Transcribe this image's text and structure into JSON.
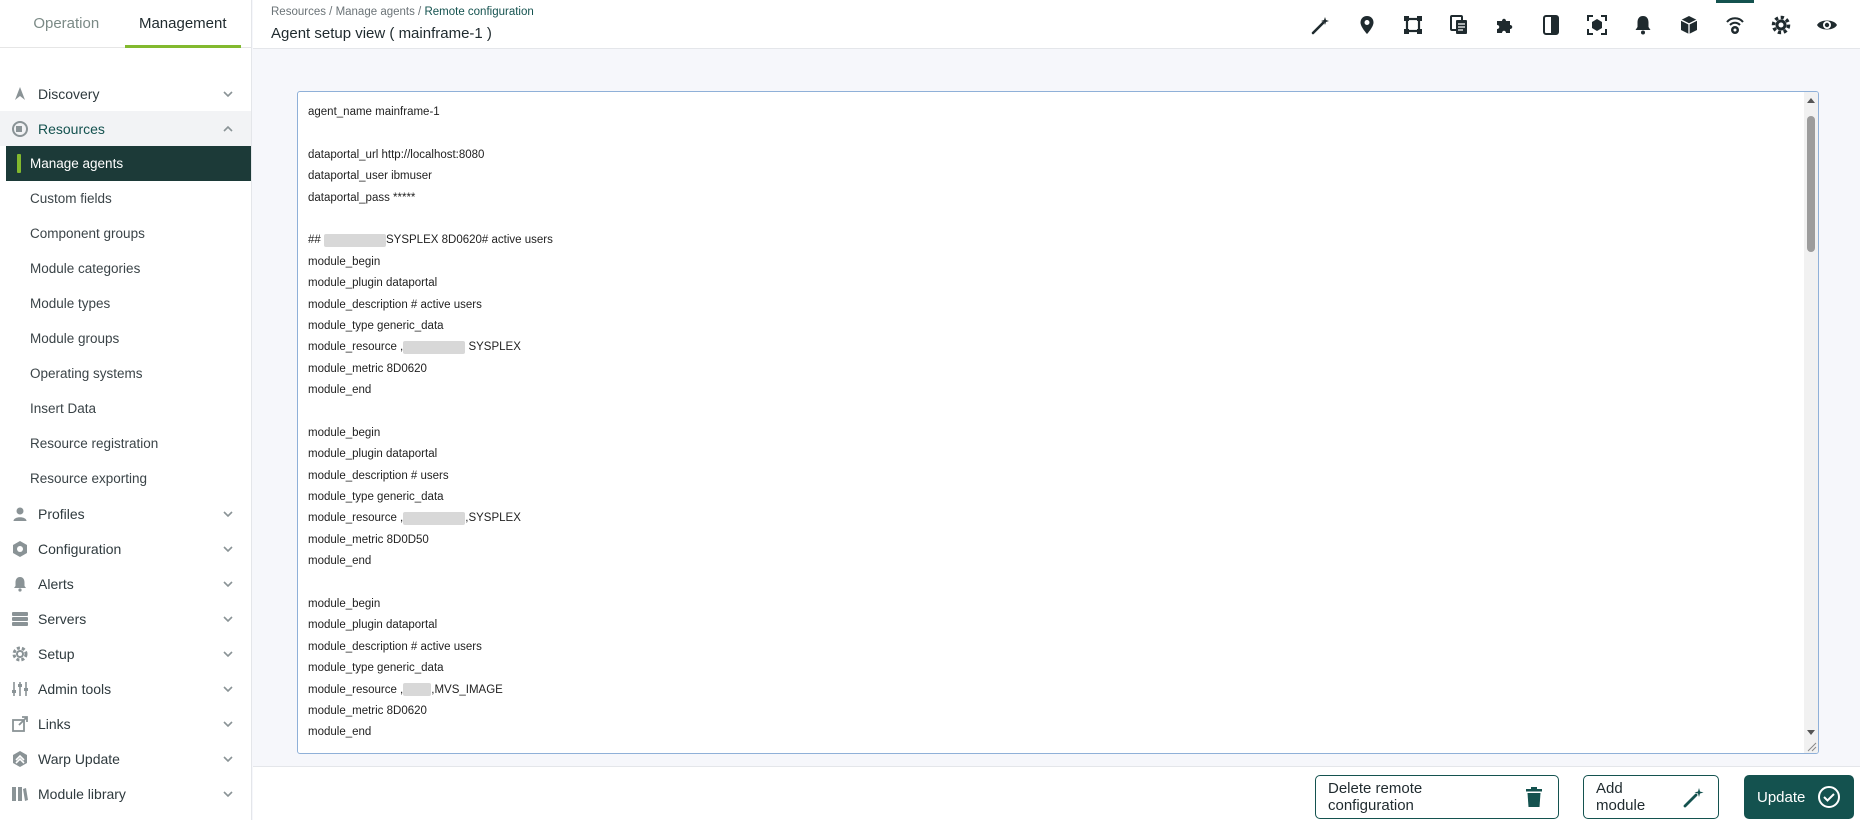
{
  "sidebar": {
    "tabs": [
      {
        "label": "Operation",
        "active": false
      },
      {
        "label": "Management",
        "active": true
      }
    ],
    "menu": {
      "discovery": "Discovery",
      "resources": "Resources",
      "resources_sub": [
        "Manage agents",
        "Custom fields",
        "Component groups",
        "Module categories",
        "Module types",
        "Module groups",
        "Operating systems",
        "Insert Data",
        "Resource registration",
        "Resource exporting"
      ],
      "profiles": "Profiles",
      "configuration": "Configuration",
      "alerts": "Alerts",
      "servers": "Servers",
      "setup": "Setup",
      "admin_tools": "Admin tools",
      "links": "Links",
      "warp_update": "Warp Update",
      "module_library": "Module library"
    }
  },
  "header": {
    "breadcrumb": {
      "part1": "Resources",
      "sep": " / ",
      "part2": "Manage agents",
      "current": "Remote configuration"
    },
    "title": "Agent setup view ( mainframe-1 )",
    "toolbar_icons": [
      "wand-icon",
      "map-pin-icon",
      "frame-icon",
      "copy-files-icon",
      "puzzle-icon",
      "panel-icon",
      "focus-icon",
      "bell-icon",
      "cube-icon",
      "wifi-gear-icon",
      "gear-icon",
      "eye-icon"
    ],
    "active_toolbar_icon": "wifi-gear-icon"
  },
  "editor": {
    "lines": [
      "agent_name mainframe-1",
      "",
      "dataportal_url http://localhost:8080",
      "dataportal_user ibmuser",
      "dataportal_pass *****",
      "",
      "## [REDACTED]SYSPLEX 8D0620# active users",
      "module_begin",
      "module_plugin dataportal",
      "module_description # active users",
      "module_type generic_data",
      "module_resource ,[REDACTED] SYSPLEX",
      "module_metric 8D0620",
      "module_end",
      "",
      "module_begin",
      "module_plugin dataportal",
      "module_description # users",
      "module_type generic_data",
      "module_resource ,[REDACTED],SYSPLEX",
      "module_metric 8D0D50",
      "module_end",
      "",
      "module_begin",
      "module_plugin dataportal",
      "module_description # active users",
      "module_type generic_data",
      "module_resource ,[REDACTED_SHORT],MVS_IMAGE",
      "module_metric 8D0620",
      "module_end"
    ]
  },
  "footer": {
    "delete_label": "Delete remote configuration",
    "add_label": "Add module",
    "update_label": "Update"
  },
  "colors": {
    "brand": "#14524f",
    "accent": "#82b92e",
    "active_bg": "#1c3a38"
  }
}
